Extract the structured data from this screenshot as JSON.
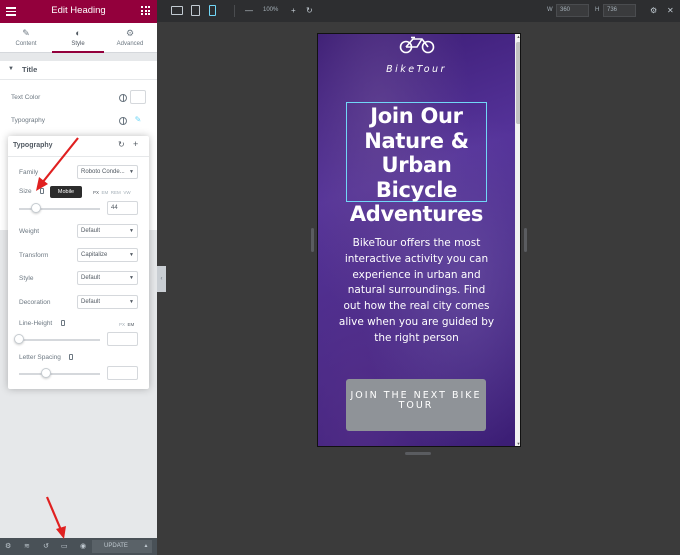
{
  "panel": {
    "title": "Edit Heading",
    "tabs": [
      {
        "label": "Content",
        "icon": "pencil-icon"
      },
      {
        "label": "Style",
        "icon": "half-circle-icon"
      },
      {
        "label": "Advanced",
        "icon": "gear-icon"
      }
    ],
    "section_title": "Title",
    "text_color_label": "Text Color",
    "typography_label": "Typography"
  },
  "typography": {
    "title": "Typography",
    "family_label": "Family",
    "family_value": "Roboto Conde...",
    "size_label": "Size",
    "size_units": [
      "PX",
      "EM",
      "REM",
      "VW"
    ],
    "size_value": "44",
    "tooltip": "Mobile",
    "weight_label": "Weight",
    "weight_value": "Default",
    "transform_label": "Transform",
    "transform_value": "Capitalize",
    "style_label": "Style",
    "style_value": "Default",
    "decoration_label": "Decoration",
    "decoration_value": "Default",
    "line_height_label": "Line-Height",
    "line_height_units": [
      "PX",
      "EM"
    ],
    "letter_spacing_label": "Letter Spacing"
  },
  "footer": {
    "update_label": "UPDATE"
  },
  "toolbar": {
    "zoom": "100%",
    "width_label": "W",
    "width_value": "360",
    "height_label": "H",
    "height_value": "736"
  },
  "preview": {
    "brand": "BikeTour",
    "heading": "Join Our Nature & Urban Bicycle Adventures",
    "description": "BikeTour offers the most interactive activity you can experience in urban and natural surroundings. Find out how the real city comes alive when you are guided by the right person",
    "cta": "JOIN THE NEXT BIKE TOUR"
  },
  "colors": {
    "brand_accent": "#93003c",
    "selection_blue": "#71d7f7",
    "annotation_red": "#e02020",
    "cta_gray": "#8f9398"
  }
}
